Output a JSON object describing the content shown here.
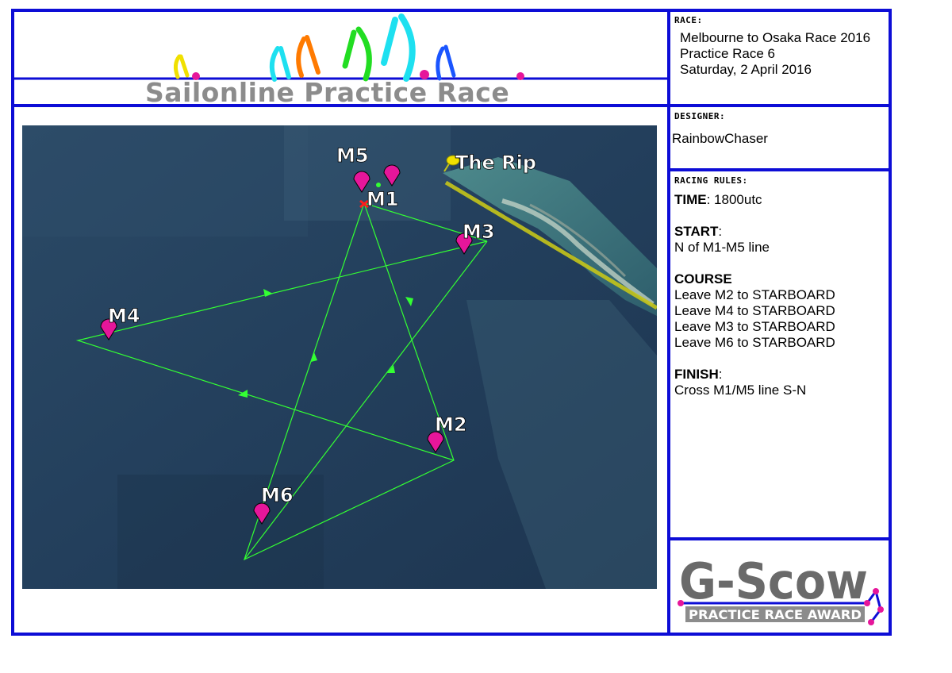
{
  "banner": {
    "title": "Sailonline Practice Race"
  },
  "race": {
    "heading": "RACE:",
    "lines": [
      "Melbourne to Osaka Race 2016",
      "Practice Race 6",
      "Saturday, 2 April 2016"
    ]
  },
  "designer": {
    "heading": "DESIGNER:",
    "name": "RainbowChaser"
  },
  "rules": {
    "heading": "RACING RULES:",
    "time_label": "TIME",
    "time_value": ": 1800utc",
    "start_label": "START",
    "start_colon": ":",
    "start_value": "N of M1-M5 line",
    "course_label": "COURSE",
    "course_items": [
      "Leave M2 to STARBOARD",
      "Leave M4 to STARBOARD",
      "Leave M3 to STARBOARD",
      "Leave M6 to STARBOARD"
    ],
    "finish_label": "FINISH",
    "finish_colon": ":",
    "finish_value": "Cross M1/M5 line S-N"
  },
  "map": {
    "marks": [
      "M5",
      "M1",
      "M3",
      "M4",
      "M2",
      "M6"
    ],
    "landmark": "The Rip",
    "mark_color": "#e6169a",
    "course_color": "#33ff33",
    "landmark_color": "#d4d400"
  },
  "logo": {
    "title": "G-Scow",
    "subtitle": "PRACTICE RACE AWARD"
  },
  "colors": {
    "border": "#0d0dd6",
    "accent_pink": "#e6169a"
  }
}
